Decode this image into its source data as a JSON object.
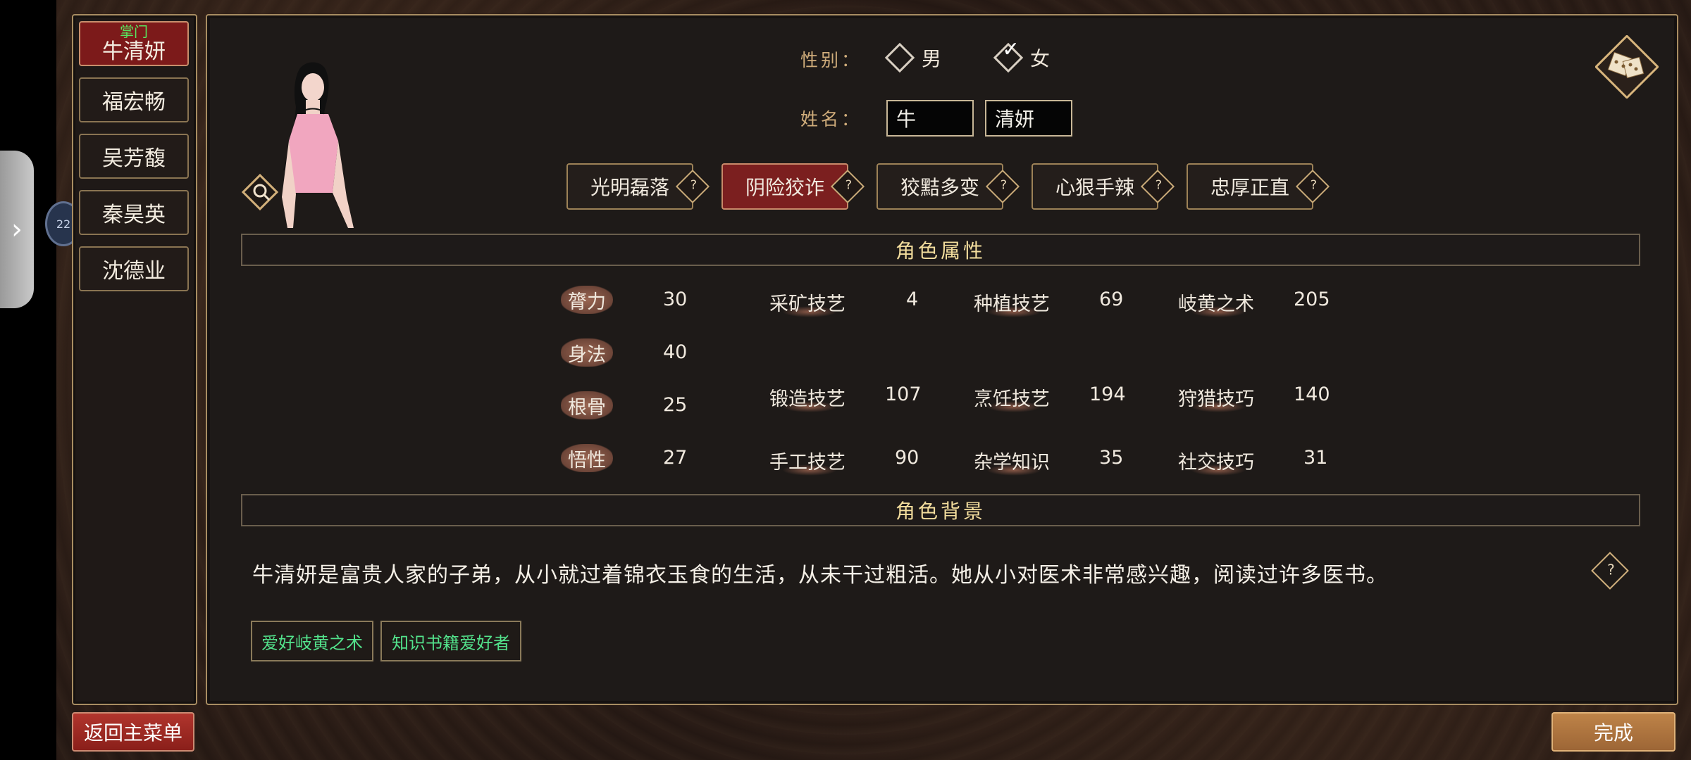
{
  "roster": {
    "active_role": "掌门",
    "items": [
      "牛清妍",
      "福宏畅",
      "吴芳馥",
      "秦昊英",
      "沈德业"
    ]
  },
  "gender": {
    "label": "性别：",
    "options": [
      "男",
      "女"
    ],
    "selected": "女"
  },
  "name": {
    "label": "姓名：",
    "surname": "牛",
    "given": "清妍"
  },
  "traits": {
    "items": [
      "光明磊落",
      "阴险狡诈",
      "狡黠多变",
      "心狠手辣",
      "忠厚正直"
    ],
    "selected": "阴险狡诈",
    "help_symbol": "?"
  },
  "attributes": {
    "title": "角色属性",
    "primary": [
      {
        "label": "膂力",
        "value": "30"
      },
      {
        "label": "身法",
        "value": "40"
      },
      {
        "label": "根骨",
        "value": "25"
      },
      {
        "label": "悟性",
        "value": "27"
      }
    ],
    "skills": [
      {
        "label": "采矿技艺",
        "value": "4"
      },
      {
        "label": "锻造技艺",
        "value": "107"
      },
      {
        "label": "手工技艺",
        "value": "90"
      },
      {
        "label": "种植技艺",
        "value": "69"
      },
      {
        "label": "烹饪技艺",
        "value": "194"
      },
      {
        "label": "杂学知识",
        "value": "35"
      },
      {
        "label": "岐黄之术",
        "value": "205"
      },
      {
        "label": "狩猎技巧",
        "value": "140"
      },
      {
        "label": "社交技巧",
        "value": "31"
      }
    ]
  },
  "background": {
    "title": "角色背景",
    "text": "牛清妍是富贵人家的子弟，从小就过着锦衣玉食的生活，从未干过粗活。她从小对医术非常感兴趣，阅读过许多医书。",
    "help_symbol": "?"
  },
  "tags": [
    "爱好岐黄之术",
    "知识书籍爱好者"
  ],
  "buttons": {
    "back": "返回主菜单",
    "finish": "完成"
  },
  "side_badge": "22",
  "side_tab_symbol": "›",
  "colors": {
    "accent_gold": "#a88d62",
    "active_red": "#7b1f1f",
    "tag_green": "#53e38c",
    "role_green": "#58e860"
  }
}
